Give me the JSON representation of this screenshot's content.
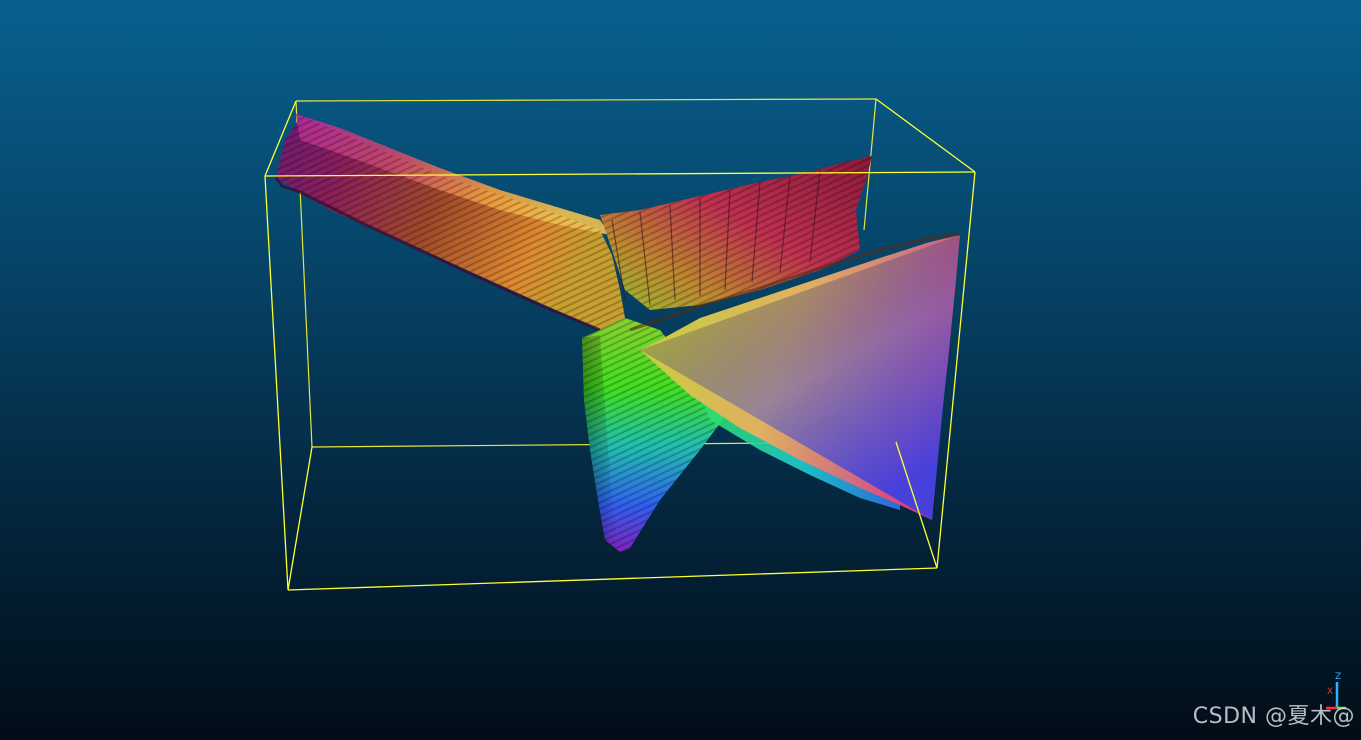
{
  "viewer": {
    "background_top_color": "#08608f",
    "background_bottom_color": "#010d17",
    "bounding_box_color": "#ffff33"
  },
  "mesh": {
    "colormap": "hsv-height",
    "colors": [
      "#7a1fd0",
      "#c21a8a",
      "#b07030",
      "#f09030",
      "#c8d84a",
      "#5ce020",
      "#20c8c8",
      "#2a6df0",
      "#8030e0",
      "#ff3080"
    ]
  },
  "axes_widget": {
    "z_label": "Z",
    "x_label": "X",
    "z_color": "#2ab6ff",
    "x_color": "#ff3030",
    "y_color": "#30ff30"
  },
  "watermark": {
    "text": "CSDN @夏木@"
  }
}
